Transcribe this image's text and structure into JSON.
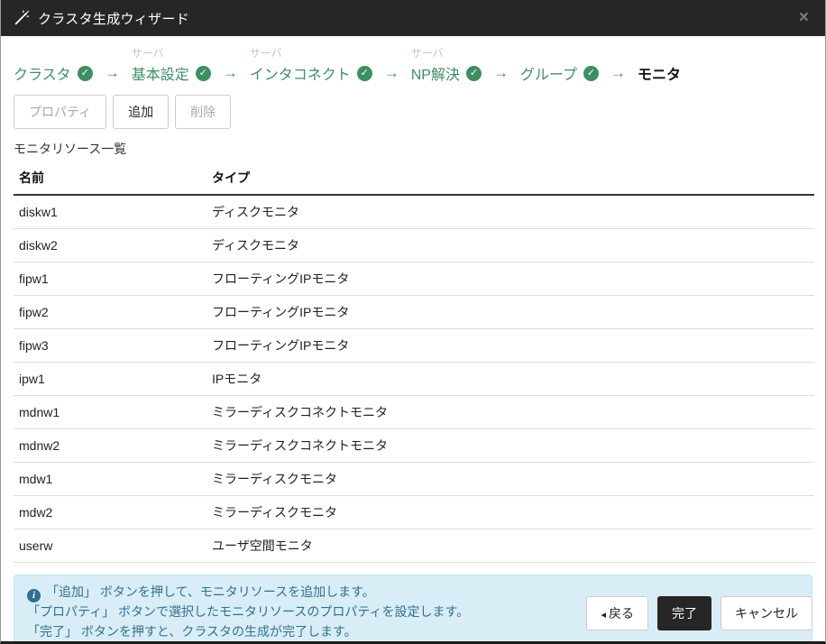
{
  "colors": {
    "accent_green": "#3e8e63",
    "light_green": "#b2d2bd",
    "titlebar_bg": "#262626",
    "info_bg": "#d9edf7",
    "info_border": "#bce8f1",
    "info_text": "#31708f"
  },
  "window": {
    "title": "クラスタ生成ウィザード",
    "close_glyph": "×"
  },
  "wizard": {
    "arrow": "→",
    "check": "✓",
    "steps": [
      {
        "sub": "",
        "label": "クラスタ",
        "status": "done"
      },
      {
        "sub": "サーバ",
        "label": "基本設定",
        "status": "done"
      },
      {
        "sub": "サーバ",
        "label": "インタコネクト",
        "status": "done"
      },
      {
        "sub": "サーバ",
        "label": "NP解決",
        "status": "done"
      },
      {
        "sub": "",
        "label": "グループ",
        "status": "done"
      },
      {
        "sub": "",
        "label": "モニタ",
        "status": "current"
      }
    ]
  },
  "toolbar": {
    "property": "プロパティ",
    "add": "追加",
    "remove": "削除"
  },
  "list": {
    "title": "モニタリソース一覧"
  },
  "table": {
    "headers": {
      "name": "名前",
      "type": "タイプ"
    },
    "rows": [
      {
        "name": "diskw1",
        "type": "ディスクモニタ"
      },
      {
        "name": "diskw2",
        "type": "ディスクモニタ"
      },
      {
        "name": "fipw1",
        "type": "フローティングIPモニタ"
      },
      {
        "name": "fipw2",
        "type": "フローティングIPモニタ"
      },
      {
        "name": "fipw3",
        "type": "フローティングIPモニタ"
      },
      {
        "name": "ipw1",
        "type": "IPモニタ"
      },
      {
        "name": "mdnw1",
        "type": "ミラーディスクコネクトモニタ"
      },
      {
        "name": "mdnw2",
        "type": "ミラーディスクコネクトモニタ"
      },
      {
        "name": "mdw1",
        "type": "ミラーディスクモニタ"
      },
      {
        "name": "mdw2",
        "type": "ミラーディスクモニタ"
      },
      {
        "name": "userw",
        "type": "ユーザ空間モニタ"
      }
    ]
  },
  "info": {
    "icon_glyph": "i",
    "lines": [
      "「追加」 ボタンを押して、モニタリソースを追加します。",
      "「プロパティ」 ボタンで選択したモニタリソースのプロパティを設定します。",
      "「完了」 ボタンを押すと、クラスタの生成が完了します。"
    ]
  },
  "footer": {
    "back_glyph": "◂",
    "back": "戻る",
    "finish": "完了",
    "cancel": "キャンセル"
  }
}
